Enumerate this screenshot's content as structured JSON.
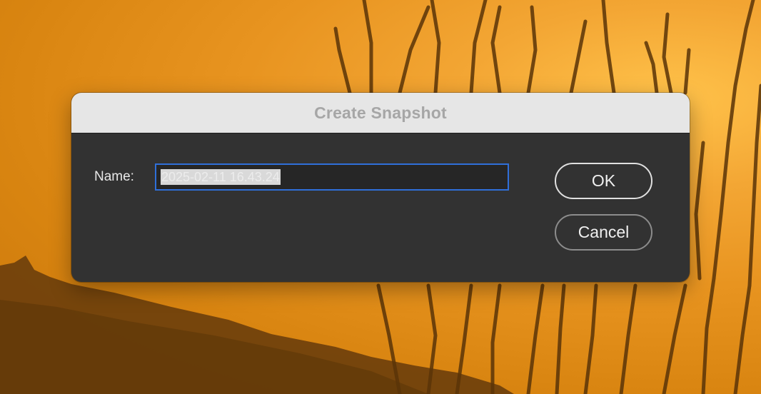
{
  "dialog": {
    "title": "Create Snapshot",
    "name_label": "Name:",
    "name_value": "2025-02-11 16.43.24",
    "ok_label": "OK",
    "cancel_label": "Cancel"
  },
  "colors": {
    "dialog_body": "#323232",
    "titlebar": "#e6e6e6",
    "focus_ring": "#2f6fd9",
    "wallpaper_sky": "#e89420",
    "wallpaper_silhouette": "#5a3408"
  }
}
